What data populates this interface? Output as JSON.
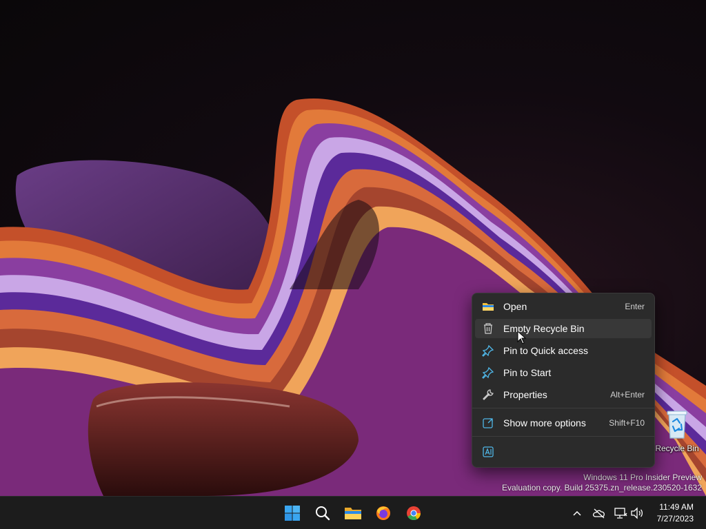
{
  "context_menu": {
    "items": [
      {
        "label": "Open",
        "accelerator": "Enter",
        "icon": "folder-icon"
      },
      {
        "label": "Empty Recycle Bin",
        "accelerator": "",
        "icon": "trash-icon"
      },
      {
        "label": "Pin to Quick access",
        "accelerator": "",
        "icon": "pin-icon"
      },
      {
        "label": "Pin to Start",
        "accelerator": "",
        "icon": "pin-icon"
      },
      {
        "label": "Properties",
        "accelerator": "Alt+Enter",
        "icon": "wrench-icon"
      },
      {
        "label": "Show more options",
        "accelerator": "Shift+F10",
        "icon": "share-icon"
      },
      {
        "label": "",
        "accelerator": "",
        "icon": "translate-icon"
      }
    ]
  },
  "desktop": {
    "recycle_bin_label": "Recycle Bin"
  },
  "watermark": {
    "line1": "Windows 11 Pro Insider Preview",
    "line2": "Evaluation copy. Build 25375.zn_release.230520-1632"
  },
  "taskbar": {
    "apps": [
      "start-icon",
      "search-icon",
      "file-explorer-icon",
      "firefox-icon",
      "chrome-icon"
    ],
    "tray": [
      "chevron-up-icon",
      "cloud-offline-icon",
      "network-icon",
      "volume-icon"
    ]
  },
  "clock": {
    "time": "11:49 AM",
    "date": "7/27/2023"
  },
  "colors": {
    "menu_bg": "#2b2b2b",
    "taskbar_bg": "#1c1c1c",
    "accent": "#0078d4"
  }
}
